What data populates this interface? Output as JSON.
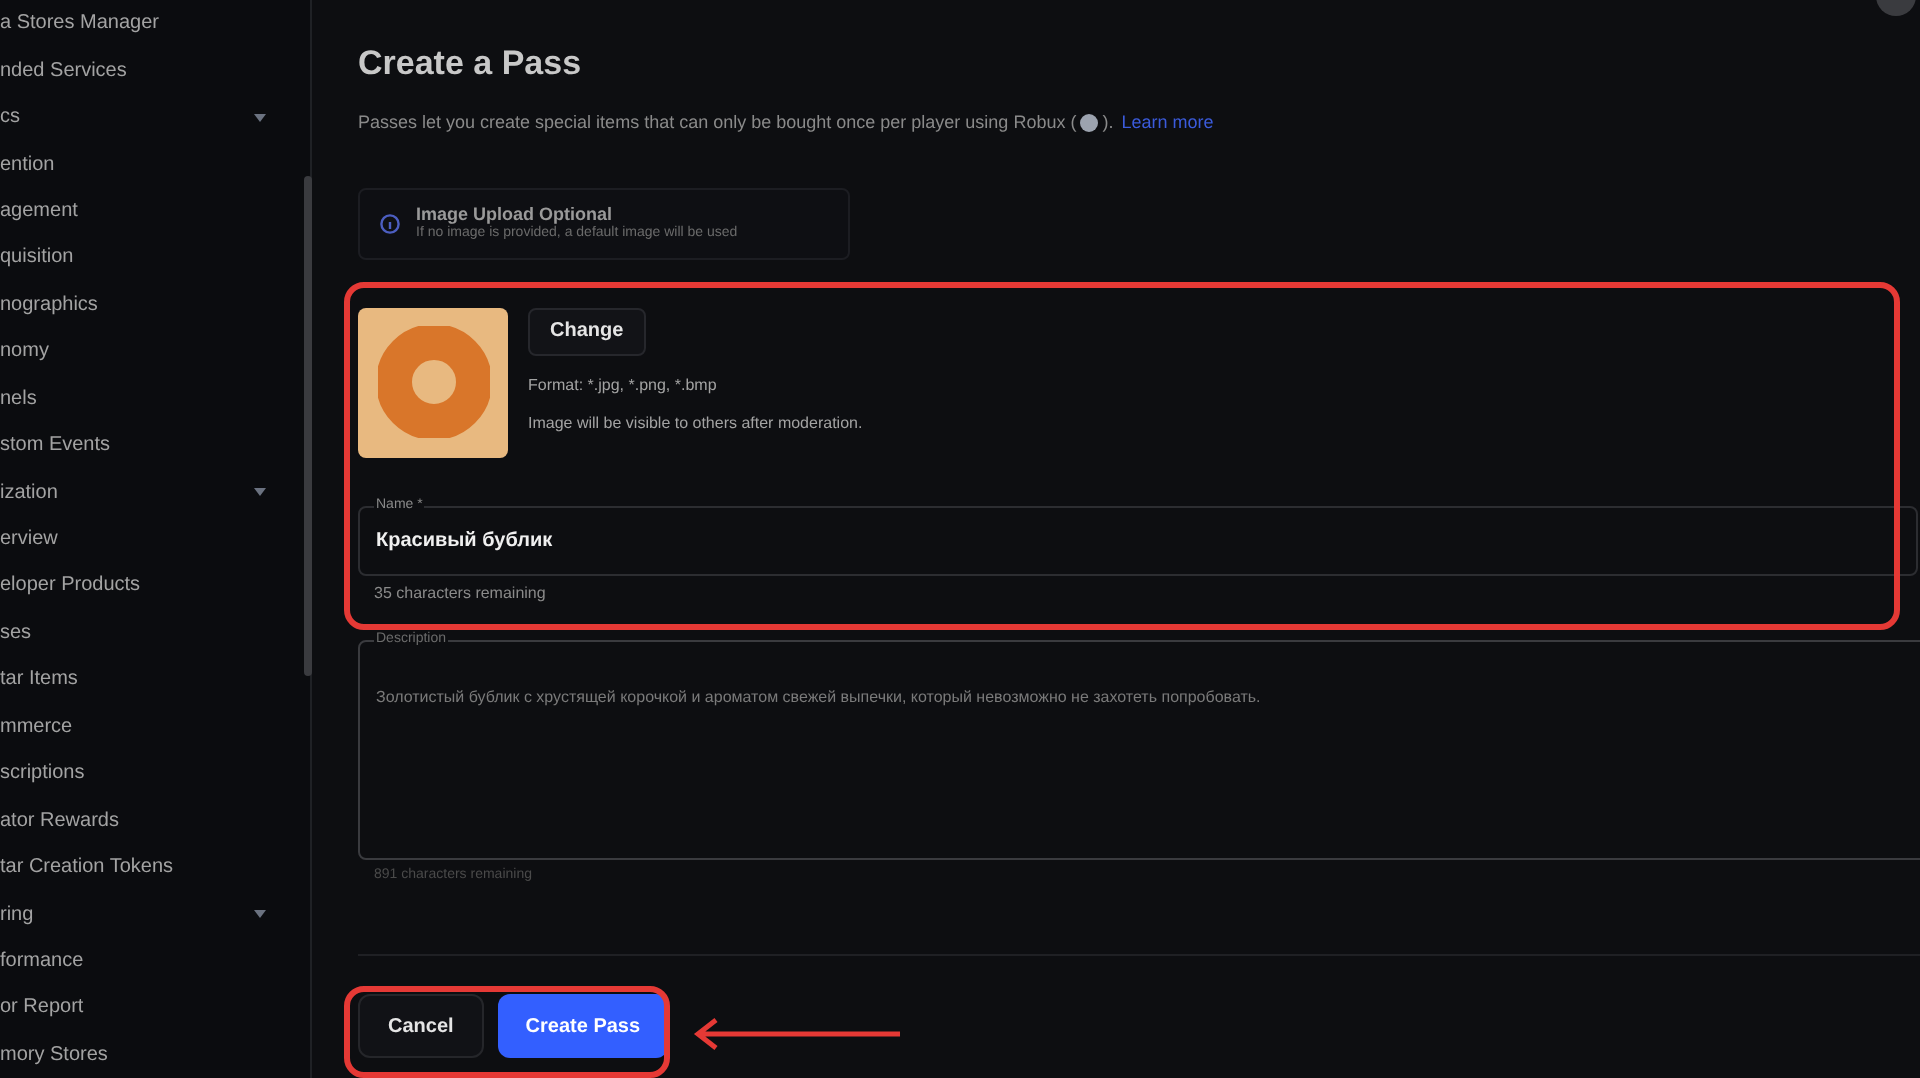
{
  "sidebar": {
    "items": [
      {
        "label": "a Stores Manager",
        "kind": "link"
      },
      {
        "label": "nded Services",
        "kind": "link"
      },
      {
        "label": "cs",
        "kind": "group"
      },
      {
        "label": "ention",
        "kind": "link"
      },
      {
        "label": "agement",
        "kind": "link"
      },
      {
        "label": "quisition",
        "kind": "link"
      },
      {
        "label": "nographics",
        "kind": "link"
      },
      {
        "label": "nomy",
        "kind": "link"
      },
      {
        "label": "nels",
        "kind": "link"
      },
      {
        "label": "stom Events",
        "kind": "link"
      },
      {
        "label": "ization",
        "kind": "group"
      },
      {
        "label": "erview",
        "kind": "link"
      },
      {
        "label": "eloper Products",
        "kind": "link"
      },
      {
        "label": "ses",
        "kind": "link"
      },
      {
        "label": "tar Items",
        "kind": "link"
      },
      {
        "label": "mmerce",
        "kind": "link"
      },
      {
        "label": "scriptions",
        "kind": "link"
      },
      {
        "label": "ator Rewards",
        "kind": "link"
      },
      {
        "label": "tar Creation Tokens",
        "kind": "link"
      },
      {
        "label": "ring",
        "kind": "group"
      },
      {
        "label": "formance",
        "kind": "link"
      },
      {
        "label": "or Report",
        "kind": "link"
      },
      {
        "label": "mory Stores",
        "kind": "link"
      }
    ]
  },
  "page": {
    "title": "Create a Pass",
    "subtitle": "Passes let you create special items that can only be bought once per player using Robux (",
    "subtitle_end": ").",
    "learn_more": "Learn more"
  },
  "notice": {
    "title": "Image Upload Optional",
    "text": "If no image is provided, a default image will be used"
  },
  "image": {
    "change_button": "Change",
    "format": "Format: *.jpg, *.png, *.bmp",
    "moderation": "Image will be visible to others after moderation."
  },
  "name_field": {
    "label": "Name *",
    "value": "Красивый бублик",
    "remaining": "35 characters remaining"
  },
  "description_field": {
    "label": "Description",
    "value": "Золотистый бублик с хрустящей корочкой и ароматом свежей выпечки, который невозможно не захотеть попробовать.",
    "remaining": "891 characters remaining"
  },
  "buttons": [
    {
      "label": "Cancel",
      "kind": "secondary"
    },
    {
      "label": "Create Pass",
      "kind": "primary"
    }
  ]
}
